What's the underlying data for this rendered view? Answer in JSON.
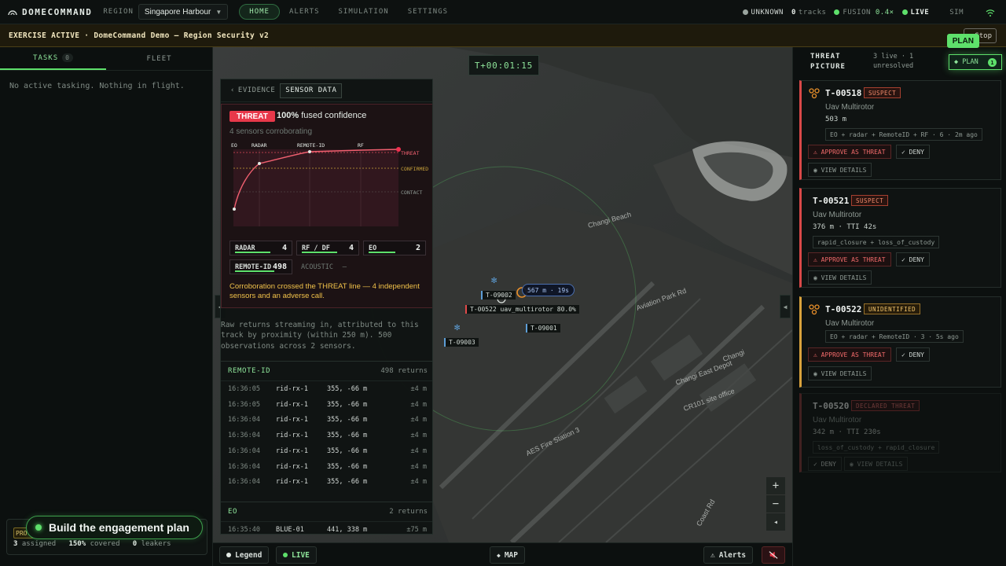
{
  "header": {
    "brand": "DOMECOMMAND",
    "region_label": "REGION",
    "region_value": "Singapore Harbour",
    "nav": [
      "HOME",
      "ALERTS",
      "SIMULATION",
      "SETTINGS"
    ],
    "status": {
      "unknown_label": "UNKNOWN",
      "tracks_count": "0",
      "tracks_label": "tracks",
      "fusion_label": "FUSION",
      "fusion_value": "0.4×",
      "live_label": "LIVE",
      "sim_label": "SIM"
    }
  },
  "banner": {
    "text": "EXERCISE ACTIVE · DomeCommand Demo — Region Security v2",
    "stop_label": "Stop",
    "plan_float": "PLAN"
  },
  "left_panel": {
    "tabs": [
      {
        "label": "TASKS",
        "count": "0"
      },
      {
        "label": "FLEET"
      }
    ],
    "empty_text": "No active tasking. Nothing in flight.",
    "badge": "PRO",
    "stats": {
      "assigned": "3",
      "assigned_label": "assigned",
      "covered": "150%",
      "covered_label": "covered",
      "leakers": "0",
      "leakers_label": "leakers"
    },
    "tooltip": "Build the engagement plan"
  },
  "map": {
    "clock": "T+00:01:15",
    "labels": [
      {
        "text": "T-09002"
      },
      {
        "text": "T-00522 uav_multirotor 80.0%"
      },
      {
        "text": "T-09001"
      },
      {
        "text": "T-09003"
      }
    ],
    "range_label": "567 m · 19s",
    "place_labels": [
      "Changi Beach",
      "Aviation Park Rd",
      "Changi East Depot",
      "CR101 site office",
      "AES Fire Station 3",
      "Changi",
      "Coast Rd"
    ],
    "zoom_in": "+",
    "zoom_out": "−",
    "compass": "◂"
  },
  "bottom_bar": {
    "legend": "Legend",
    "live": "LIVE",
    "map": "MAP",
    "alerts": "Alerts"
  },
  "evidence": {
    "tabs": [
      "EVIDENCE",
      "SENSOR DATA"
    ],
    "threat_pill": "THREAT",
    "confidence_value": "100%",
    "confidence_text": "fused confidence",
    "corroborating": "4 sensors corroborating",
    "chart_sensor_labels": [
      "EO",
      "RADAR",
      "REMOTE-ID",
      "RF"
    ],
    "chart_zone_labels": [
      "THREAT",
      "CONFIRMED",
      "CONTACT"
    ],
    "sensors": [
      {
        "name": "RADAR",
        "count": "4",
        "fill": 0.8
      },
      {
        "name": "RF / DF",
        "count": "4",
        "fill": 0.8
      },
      {
        "name": "EO",
        "count": "2",
        "fill": 0.6
      },
      {
        "name": "REMOTE-ID",
        "count": "498",
        "fill": 0.9
      },
      {
        "name": "ACOUSTIC",
        "count": "—",
        "fill": 0
      }
    ],
    "corroboration_msg": "Corroboration crossed the THREAT line — 4 independent sensors and an adverse call.",
    "raw_note": "Raw returns streaming in, attributed to this track by proximity (within 250 m). 500 observations across 2 sensors.",
    "remote_id": {
      "title": "REMOTE-ID",
      "count": "498 returns",
      "rows": [
        {
          "time": "16:36:05",
          "sensor": "rid-rx-1",
          "pos": "355, -66 m",
          "acc": "±4 m"
        },
        {
          "time": "16:36:05",
          "sensor": "rid-rx-1",
          "pos": "355, -66 m",
          "acc": "±4 m"
        },
        {
          "time": "16:36:04",
          "sensor": "rid-rx-1",
          "pos": "355, -66 m",
          "acc": "±4 m"
        },
        {
          "time": "16:36:04",
          "sensor": "rid-rx-1",
          "pos": "355, -66 m",
          "acc": "±4 m"
        },
        {
          "time": "16:36:04",
          "sensor": "rid-rx-1",
          "pos": "355, -66 m",
          "acc": "±4 m"
        },
        {
          "time": "16:36:04",
          "sensor": "rid-rx-1",
          "pos": "355, -66 m",
          "acc": "±4 m"
        },
        {
          "time": "16:36:04",
          "sensor": "rid-rx-1",
          "pos": "355, -66 m",
          "acc": "±4 m"
        }
      ]
    },
    "eo": {
      "title": "EO",
      "count": "2 returns",
      "rows": [
        {
          "time": "16:35:40",
          "sensor": "BLUE-01",
          "pos": "441, 338 m",
          "acc": "±75 m"
        }
      ]
    }
  },
  "right_panel": {
    "title_line1": "THREAT",
    "title_line2": "PICTURE",
    "sub_line1": "3 live · 1",
    "sub_line2": "unresolved",
    "plan_label": "◆ PLAN",
    "plan_count": "1",
    "cards": [
      {
        "id": "T-00518",
        "badge": "SUSPECT",
        "type": "Uav Multirotor",
        "dist": "503 m",
        "meta": "EO + radar + RemoteID + RF · 6 · 2m ago",
        "approve": "⚠ APPROVE AS THREAT",
        "deny": "✓ DENY",
        "details": "◉ VIEW DETAILS"
      },
      {
        "id": "T-00521",
        "badge": "SUSPECT",
        "type": "Uav Multirotor",
        "dist": "376 m · TTI 42s",
        "meta": "rapid_closure + loss_of_custody",
        "approve": "⚠ APPROVE AS THREAT",
        "deny": "✓ DENY",
        "details": "◉ VIEW DETAILS"
      },
      {
        "id": "T-00522",
        "badge": "UNIDENTIFIED",
        "type": "Uav Multirotor",
        "dist": "",
        "meta": "EO + radar + RemoteID · 3 · 5s ago",
        "approve": "⚠ APPROVE AS THREAT",
        "deny": "✓ DENY",
        "details": "◉ VIEW DETAILS"
      },
      {
        "id": "T-00520",
        "badge": "DECLARED THREAT",
        "type": "Uav Multirotor",
        "dist": "342 m · TTI 230s",
        "meta": "loss_of_custody + rapid_closure",
        "deny": "✓ DENY",
        "details": "◉ VIEW DETAILS"
      }
    ]
  },
  "colors": {
    "accent": "#5ee06b",
    "threat": "#e8384a",
    "warning": "#f1c24a"
  }
}
